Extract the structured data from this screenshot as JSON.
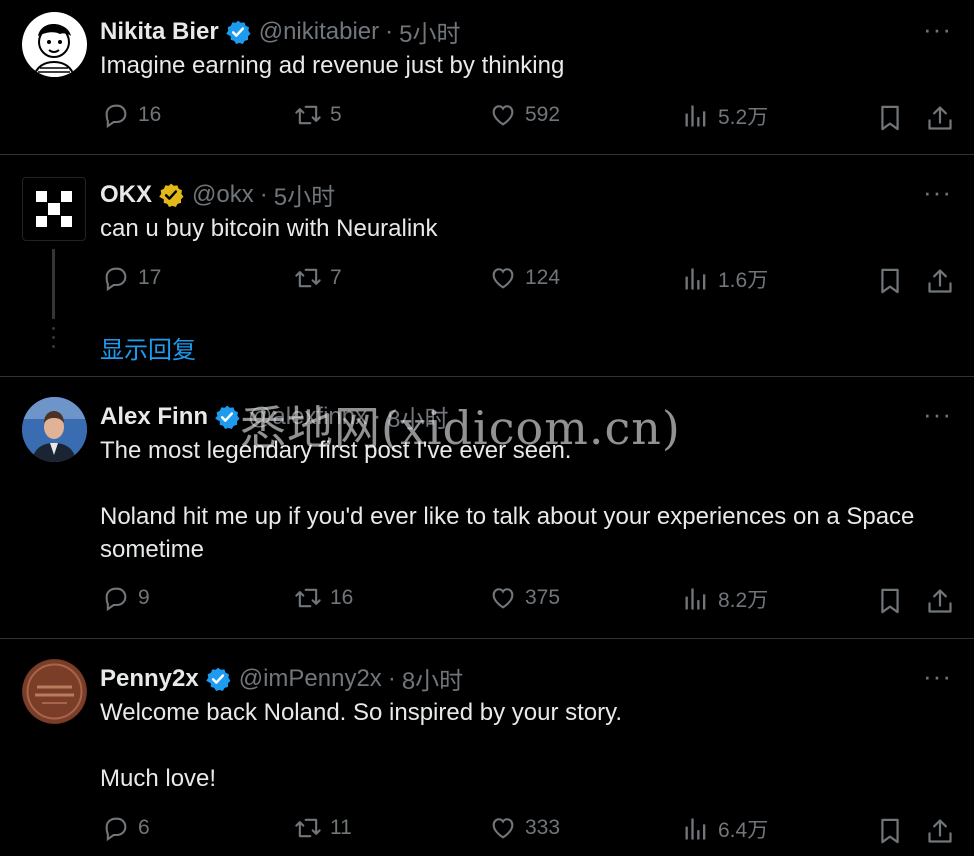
{
  "colors": {
    "background": "#000000",
    "text": "#e7e9ea",
    "muted": "#71767b",
    "accent": "#1d9bf0",
    "gold_badge": "#e2b719",
    "divider": "#2f3336"
  },
  "tweets": [
    {
      "name": "Nikita Bier",
      "verified": "blue",
      "handle": "@nikitabier",
      "time": "5小时",
      "text": [
        "Imagine earning ad revenue just by thinking"
      ],
      "replies": "16",
      "retweets": "5",
      "likes": "592",
      "views": "5.2万",
      "avatar": "cartoon-face-avatar"
    },
    {
      "name": "OKX",
      "verified": "gold",
      "handle": "@okx",
      "time": "5小时",
      "text": [
        "can u buy bitcoin with Neuralink"
      ],
      "replies": "17",
      "retweets": "7",
      "likes": "124",
      "views": "1.6万",
      "avatar": "okx-logo-avatar"
    },
    {
      "name": "Alex Finn",
      "verified": "blue",
      "handle": "@alexfinnx",
      "time": "8小时",
      "text": [
        "The most legendary first post I've ever seen.",
        "Noland hit me up if you'd ever like to talk about your experiences on a Space sometime"
      ],
      "replies": "9",
      "retweets": "16",
      "likes": "375",
      "views": "8.2万",
      "avatar": "man-in-suit-avatar"
    },
    {
      "name": "Penny2x",
      "verified": "blue",
      "handle": "@imPenny2x",
      "time": "8小时",
      "text": [
        "Welcome back Noland. So inspired by your story.",
        "Much love!"
      ],
      "replies": "6",
      "retweets": "11",
      "likes": "333",
      "views": "6.4万",
      "avatar": "penny-coin-avatar"
    }
  ],
  "show_replies": "显示回复",
  "more": "···",
  "separator": "·",
  "watermark": "悉地网(xidicom.cn)"
}
